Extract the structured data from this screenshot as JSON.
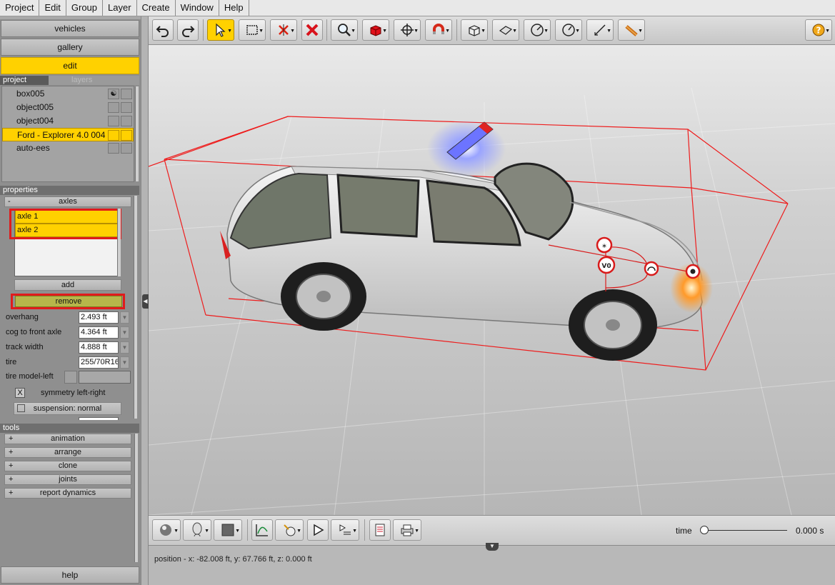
{
  "menu": [
    "Project",
    "Edit",
    "Group",
    "Layer",
    "Create",
    "Window",
    "Help"
  ],
  "nav": {
    "vehicles": "vehicles",
    "gallery": "gallery",
    "edit": "edit"
  },
  "tabs": {
    "project": "project",
    "layers": "layers"
  },
  "objects": [
    {
      "name": "box005"
    },
    {
      "name": "object005"
    },
    {
      "name": "object004"
    },
    {
      "name": "Ford - Explorer 4.0 004",
      "selected": true
    },
    {
      "name": "auto-ees"
    }
  ],
  "properties": {
    "header": "properties",
    "axles_section": {
      "toggle": "-",
      "label": "axles"
    },
    "axles": [
      "axle 1",
      "axle 2"
    ],
    "add_label": "add",
    "remove_label": "remove",
    "fields": [
      {
        "label": "overhang",
        "value": "2.493 ft"
      },
      {
        "label": "cog to front axle",
        "value": "4.364 ft"
      },
      {
        "label": "track width",
        "value": "4.888 ft"
      },
      {
        "label": "tire",
        "value": "255/70R16"
      }
    ],
    "tire_model_label": "tire model-left",
    "symmetry_check": "X",
    "symmetry_label": "symmetry left-right",
    "suspension_label": "suspension: normal"
  },
  "tools": {
    "header": "tools",
    "items": [
      "animation",
      "arrange",
      "clone",
      "joints",
      "report dynamics"
    ],
    "toggle": "+"
  },
  "help_label": "help",
  "timeline": {
    "label": "time",
    "value": "0.000 s"
  },
  "status": {
    "position": "position - x: -82.008 ft, y: 67.766 ft, z: 0.000 ft"
  },
  "viewport": {
    "markers": [
      "V0"
    ]
  },
  "colors": {
    "accent": "#ffd100",
    "highlight": "#e11b1b"
  }
}
